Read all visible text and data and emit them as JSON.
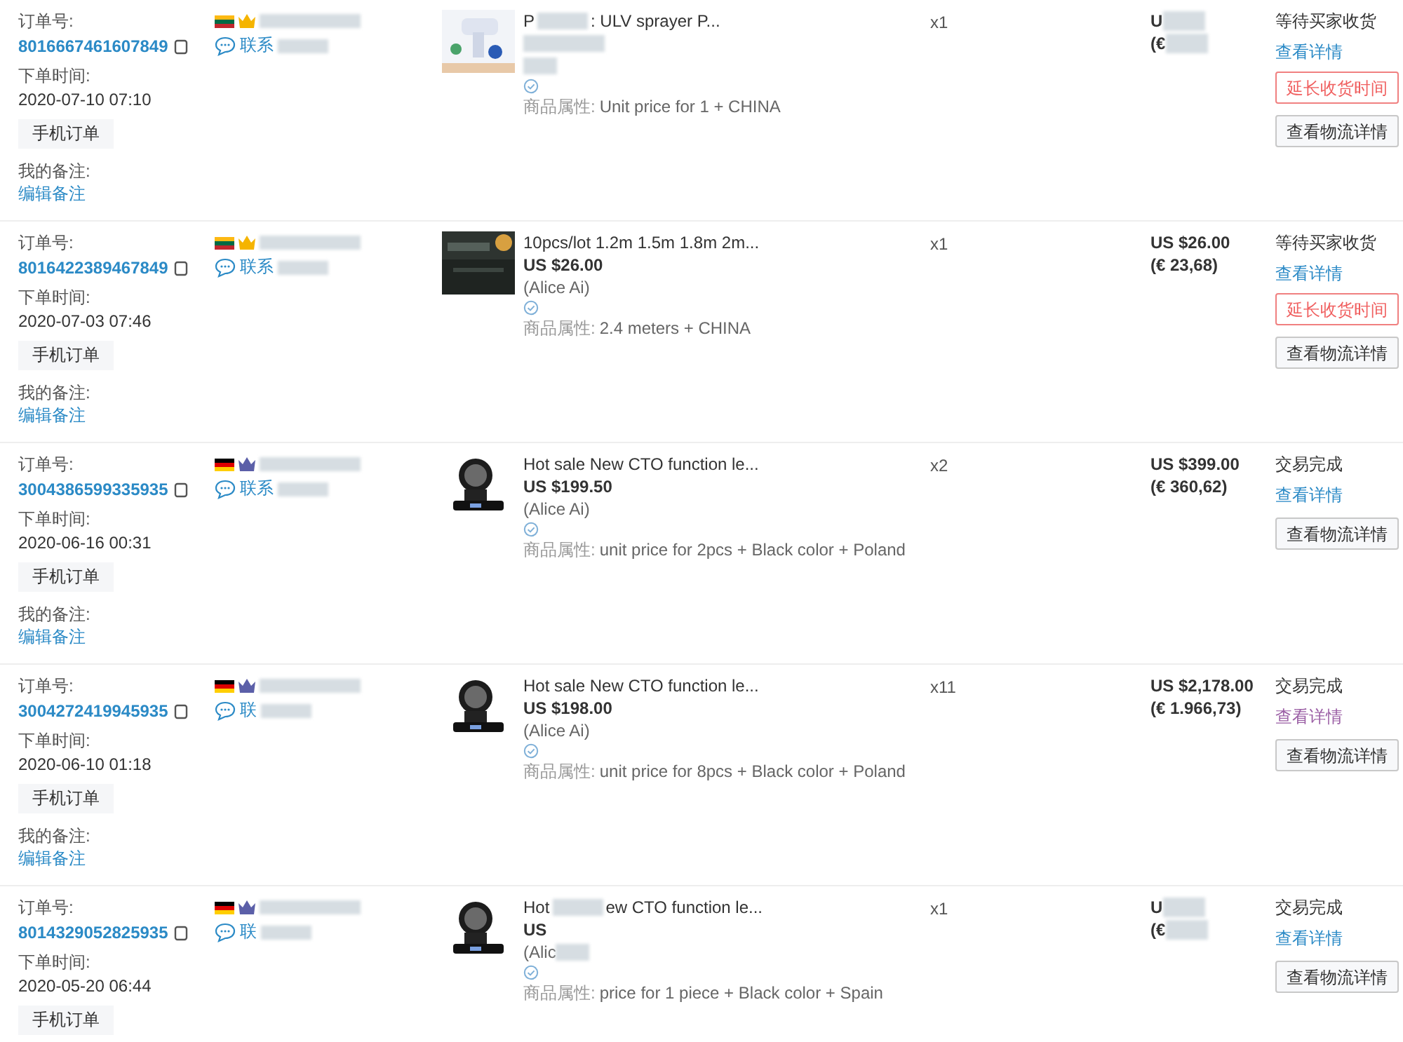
{
  "orders": [
    {
      "order_label": "订单号:",
      "order_no": "8016667461607849",
      "time_label": "下单时间:",
      "time": "2020-07-10 07:10",
      "mobile_tag": "手机订单",
      "remark_label": "我的备注:",
      "remark_link": "编辑备注",
      "buyer": {
        "kind": "lithuania",
        "color": "#f5b400"
      },
      "contact": "联系",
      "product": {
        "kind": "sprayer",
        "title_start": "P",
        "title_end": ": ULV sprayer P...",
        "qty": "x1",
        "attr_label": "商品属性:",
        "attr": "Unit price for 1 + CHINA"
      },
      "total": {
        "usd": "U",
        "eur": "(€"
      },
      "status": "等待买家收货",
      "detail_link": "查看详情",
      "detail_visited": false,
      "extend_button": "延长收货时间",
      "logistics_button": "查看物流详情"
    },
    {
      "order_label": "订单号:",
      "order_no": "8016422389467849",
      "time_label": "下单时间:",
      "time": "2020-07-03 07:46",
      "mobile_tag": "手机订单",
      "remark_label": "我的备注:",
      "remark_link": "编辑备注",
      "buyer": {
        "kind": "lithuania",
        "color": "#f5b400"
      },
      "contact": "联系",
      "product": {
        "kind": "cables",
        "title": "10pcs/lot 1.2m 1.5m 1.8m 2m...",
        "price": "US $26.00",
        "seller": "(Alice Ai)",
        "qty": "x1",
        "attr_label": "商品属性:",
        "attr": "2.4 meters + CHINA"
      },
      "total": {
        "usd": "US $26.00",
        "eur": "(€ 23,68)"
      },
      "status": "等待买家收货",
      "detail_link": "查看详情",
      "detail_visited": false,
      "extend_button": "延长收货时间",
      "logistics_button": "查看物流详情"
    },
    {
      "order_label": "订单号:",
      "order_no": "3004386599335935",
      "time_label": "下单时间:",
      "time": "2020-06-16 00:31",
      "mobile_tag": "手机订单",
      "remark_label": "我的备注:",
      "remark_link": "编辑备注",
      "buyer": {
        "kind": "germany",
        "color": "#5b5fa8"
      },
      "contact": "联系",
      "product": {
        "kind": "light",
        "title": "Hot sale New CTO function le...",
        "price": "US $199.50",
        "seller": "(Alice Ai)",
        "qty": "x2",
        "attr_label": "商品属性:",
        "attr": "unit price for 2pcs + Black color + Poland"
      },
      "total": {
        "usd": "US $399.00",
        "eur": "(€ 360,62)"
      },
      "status": "交易完成",
      "detail_link": "查看详情",
      "detail_visited": false,
      "logistics_button": "查看物流详情"
    },
    {
      "order_label": "订单号:",
      "order_no": "3004272419945935",
      "time_label": "下单时间:",
      "time": "2020-06-10 01:18",
      "mobile_tag": "手机订单",
      "remark_label": "我的备注:",
      "remark_link": "编辑备注",
      "buyer": {
        "kind": "germany",
        "color": "#5b5fa8"
      },
      "contact": "联",
      "product": {
        "kind": "light",
        "title": "Hot sale New CTO function le...",
        "price": "US $198.00",
        "seller": "(Alice Ai)",
        "qty": "x11",
        "attr_label": "商品属性:",
        "attr": "unit price for 8pcs + Black color + Poland"
      },
      "total": {
        "usd": "US $2,178.00",
        "eur": "(€ 1.966,73)"
      },
      "status": "交易完成",
      "detail_link": "查看详情",
      "detail_visited": true,
      "logistics_button": "查看物流详情"
    },
    {
      "order_label": "订单号:",
      "order_no": "8014329052825935",
      "time_label": "下单时间:",
      "time": "2020-05-20 06:44",
      "mobile_tag": "手机订单",
      "buyer": {
        "kind": "germany",
        "color": "#5b5fa8"
      },
      "contact": "联",
      "product": {
        "kind": "light",
        "title_start": "Hot",
        "title_end": "ew CTO function le...",
        "price": "US",
        "seller": "(Alic",
        "qty": "x1",
        "attr_label": "商品属性:",
        "attr": "price for 1 piece + Black color + Spain"
      },
      "total": {
        "usd": "U",
        "eur": "(€"
      },
      "status": "交易完成",
      "detail_link": "查看详情",
      "detail_visited": false,
      "logistics_button": "查看物流详情"
    }
  ]
}
